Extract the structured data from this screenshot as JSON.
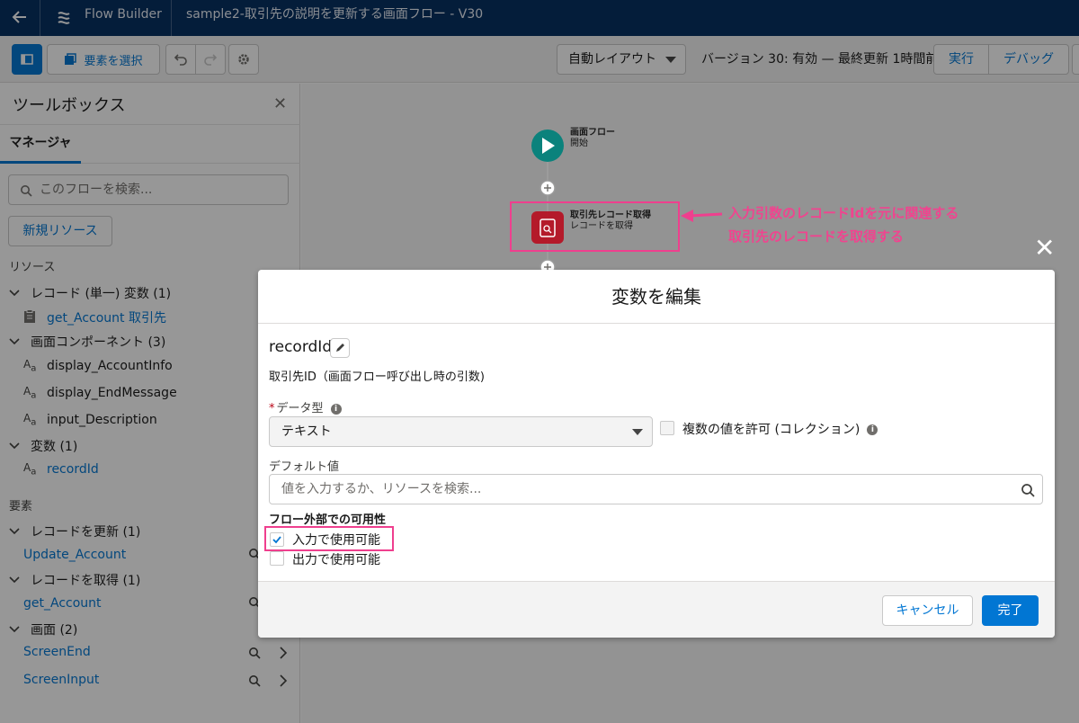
{
  "topbar": {
    "app_name": "Flow Builder",
    "flow_title": "sample2-取引先の説明を更新する画面フロー - V30"
  },
  "toolbar": {
    "select_elements_label": "要素を選択",
    "layout_value": "自動レイアウト",
    "status_text": "バージョン 30: 有効 — 最終更新 1時間前",
    "run_label": "実行",
    "debug_label": "デバッグ"
  },
  "toolbox": {
    "title": "ツールボックス",
    "tab_manager": "マネージャ",
    "search_placeholder": "このフローを検索...",
    "new_resource_label": "新規リソース",
    "resources_section": "リソース",
    "resource_groups": [
      {
        "label": "レコード (単一) 変数 (1)",
        "items": [
          {
            "label": "get_Account 取引先"
          }
        ]
      },
      {
        "label": "画面コンポーネント (3)",
        "items": [
          {
            "label": "display_AccountInfo"
          },
          {
            "label": "display_EndMessage"
          },
          {
            "label": "input_Description"
          }
        ]
      },
      {
        "label": "変数 (1)",
        "items": [
          {
            "label": "recordId"
          }
        ]
      }
    ],
    "elements_section": "要素",
    "element_groups": [
      {
        "label": "レコードを更新 (1)",
        "items": [
          {
            "label": "Update_Account"
          }
        ]
      },
      {
        "label": "レコードを取得 (1)",
        "items": [
          {
            "label": "get_Account"
          }
        ]
      },
      {
        "label": "画面 (2)",
        "items": [
          {
            "label": "ScreenEnd"
          },
          {
            "label": "ScreenInput"
          }
        ]
      }
    ]
  },
  "canvas": {
    "start_title": "画面フロー",
    "start_sub": "開始",
    "get_title": "取引先レコード取得",
    "get_sub": "レコードを取得"
  },
  "annotation": {
    "line1": "入力引数のレコードIdを元に関連する",
    "line2": "取引先のレコードを取得する",
    "color": "#f0448f"
  },
  "modal": {
    "title": "変数を編集",
    "api_name": "recordId",
    "description": "取引先ID（画面フロー呼び出し時の引数)",
    "data_type_label": "データ型",
    "data_type_value": "テキスト",
    "multiple_label": "複数の値を許可 (コレクション)",
    "default_label": "デフォルト値",
    "default_placeholder": "値を入力するか、リソースを検索...",
    "availability_label": "フロー外部での可用性",
    "input_label": "入力で使用可能",
    "output_label": "出力で使用可能",
    "input_checked": true,
    "output_checked": false,
    "cancel_label": "キャンセル",
    "done_label": "完了"
  },
  "colors": {
    "brand": "#0176d3",
    "header": "#032d60",
    "highlight": "#ef3f8e",
    "start_node": "#0b827c",
    "get_node": "#ba0517"
  }
}
